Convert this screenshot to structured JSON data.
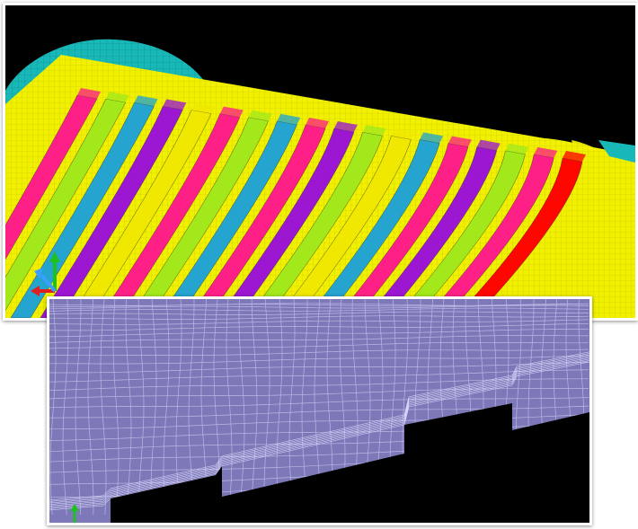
{
  "figure": {
    "top_view": {
      "kind": "3d-mesh",
      "background": "#000000",
      "mesh_lines": "#c8c800",
      "colors": {
        "cylinder": "#18b8b8",
        "slab": "#f0f000",
        "strips": [
          "#ff1a8c",
          "#a0e81c",
          "#1ea2d6",
          "#9a10d8",
          "#f0e800",
          "#ff1a8c",
          "#a0e81c",
          "#1ea2d6",
          "#ff1a8c",
          "#9a10d8",
          "#a0e81c",
          "#f0e800",
          "#1ea2d6",
          "#ff1a8c",
          "#9a10d8",
          "#a0e81c",
          "#ff1a8c",
          "#ff0000"
        ]
      }
    },
    "bottom_view": {
      "kind": "2d-mesh",
      "background": "#000000",
      "mesh_fill": "#7d78b8",
      "mesh_lines": "#c6c4ee"
    },
    "axis_triad_colors": {
      "x": "#e02020",
      "y": "#20c020",
      "z": "#3aa0ff"
    }
  }
}
